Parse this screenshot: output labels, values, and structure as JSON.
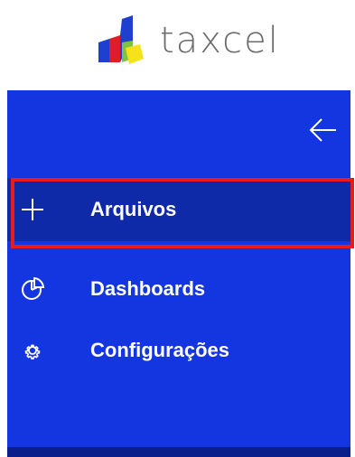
{
  "brand": {
    "name": "taxcel",
    "colors": {
      "bar_blue": "#1f3fd1",
      "bar_red": "#e21b2b",
      "bar_green": "#7fc242",
      "bar_yellow": "#f6e21b"
    }
  },
  "sidebar": {
    "background": "#1436e0",
    "collapse_icon": "arrow-left-icon",
    "items": [
      {
        "label": "Arquivos",
        "icon": "plus-icon",
        "active": true
      },
      {
        "label": "Dashboards",
        "icon": "pie-chart-icon",
        "active": false
      },
      {
        "label": "Configurações",
        "icon": "gear-icon",
        "active": false
      }
    ]
  }
}
